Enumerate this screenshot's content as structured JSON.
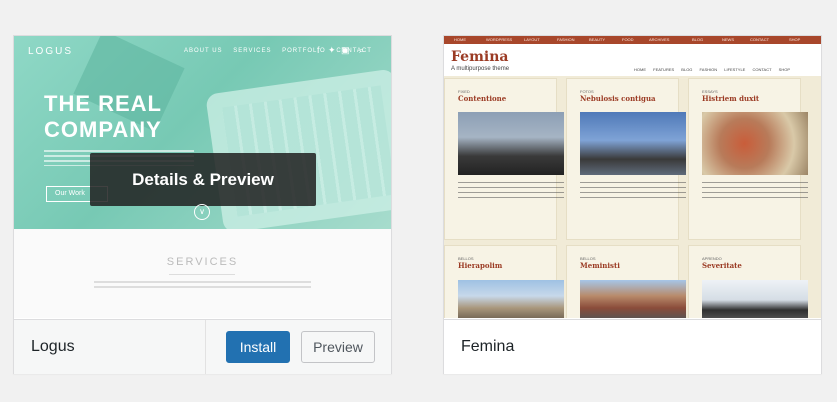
{
  "colors": {
    "install_blue": "#2271b1",
    "femina_accent": "#9b3b24",
    "logus_teal": "#77c9b4"
  },
  "themes": [
    {
      "name": "Logus",
      "install_label": "Install",
      "preview_label": "Preview",
      "overlay_label": "Details & Preview",
      "screenshot": {
        "logo": "LOGUS",
        "nav": [
          "ABOUT US",
          "SERVICES",
          "PORTFOLIO",
          "CONTACT"
        ],
        "hero_title_line1": "THE REAL",
        "hero_title_line2": "COMPANY",
        "hero_badge": "HTML&CSS",
        "cta": "Our Work",
        "services_title": "SERVICES"
      }
    },
    {
      "name": "Femina",
      "screenshot": {
        "title": "Femina",
        "tagline": "A multipurpose theme",
        "topbar": [
          "HOME",
          "WORDPRESS",
          "LAYOUT",
          "FASHION",
          "BEAUTY",
          "FOOD",
          "ARCHIVES",
          "BLOG",
          "NEWS",
          "CONTACT",
          "SHOP"
        ],
        "nav": [
          "HOME",
          "FEATURES",
          "BLOG",
          "FASHION",
          "LIFESTYLE",
          "CONTACT",
          "SHOP"
        ],
        "posts": [
          {
            "category": "FIXED",
            "title": "Contentione"
          },
          {
            "category": "FOTOS",
            "title": "Nebulosis contigua"
          },
          {
            "category": "ESSAYS",
            "title": "Histriem duxit"
          },
          {
            "category": "BELLOS",
            "title": "Hierapolim"
          },
          {
            "category": "BELLOS",
            "title": "Meministi"
          },
          {
            "category": "APRENDO",
            "title": "Severitate"
          }
        ]
      }
    }
  ]
}
